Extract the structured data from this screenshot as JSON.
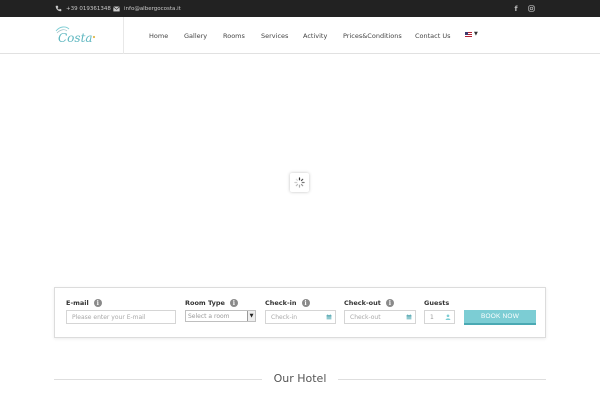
{
  "topbar": {
    "phone": "+39 019361348",
    "email": "info@albergocosta.it",
    "phone_icon": "phone-icon",
    "email_icon": "envelope-icon",
    "social": [
      "facebook-icon",
      "instagram-icon"
    ]
  },
  "logo": {
    "text": "Costa"
  },
  "nav": {
    "items": [
      "Home",
      "Gallery",
      "Rooms",
      "Services",
      "Activity",
      "Prices&Conditions",
      "Contact Us"
    ],
    "language_icon": "us-flag-icon"
  },
  "hero": {
    "loading_icon": "spinner-icon"
  },
  "booking": {
    "email_label": "E-mail",
    "email_placeholder": "Please enter your E-mail",
    "room_label": "Room Type",
    "room_selected": "Select a room",
    "checkin_label": "Check-in",
    "checkin_placeholder": "Check-in",
    "checkout_label": "Check-out",
    "checkout_placeholder": "Check-out",
    "guests_label": "Guests",
    "guests_value": "1",
    "book_button": "BOOK NOW",
    "info_icon": "i"
  },
  "section": {
    "title": "Our Hotel"
  },
  "colors": {
    "topbar_bg": "#222222",
    "accent": "#7ccdd4",
    "accent_dark": "#4aa9b3",
    "text": "#444444"
  }
}
